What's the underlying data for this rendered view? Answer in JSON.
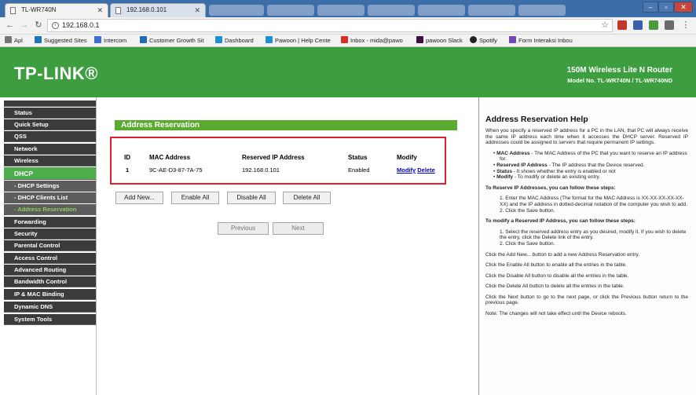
{
  "browser": {
    "tabs": [
      {
        "title": "TL-WR740N"
      },
      {
        "title": "192.168.0.101"
      }
    ],
    "url": "192.168.0.1",
    "bookmarks": [
      {
        "label": "Apl"
      },
      {
        "label": "Suggested Sites"
      },
      {
        "label": "Intercom"
      },
      {
        "label": "Customer Growth Sit"
      },
      {
        "label": "Dashboard"
      },
      {
        "label": "Pawoon | Help Cente"
      },
      {
        "label": "Inbox - mida@pawo"
      },
      {
        "label": "pawoon Slack"
      },
      {
        "label": "Spotify"
      },
      {
        "label": "Form Interaksi Inbou"
      }
    ]
  },
  "header": {
    "logo": "TP-LINK®",
    "product": "150M Wireless Lite N Router",
    "model": "Model No. TL-WR740N / TL-WR740ND"
  },
  "sidebar": {
    "items": [
      {
        "label": "Status"
      },
      {
        "label": "Quick Setup"
      },
      {
        "label": "QSS"
      },
      {
        "label": "Network"
      },
      {
        "label": "Wireless"
      },
      {
        "label": "DHCP"
      },
      {
        "label": "- DHCP Settings"
      },
      {
        "label": "- DHCP Clients List"
      },
      {
        "label": "- Address Reservation"
      },
      {
        "label": "Forwarding"
      },
      {
        "label": "Security"
      },
      {
        "label": "Parental Control"
      },
      {
        "label": "Access Control"
      },
      {
        "label": "Advanced Routing"
      },
      {
        "label": "Bandwidth Control"
      },
      {
        "label": "IP & MAC Binding"
      },
      {
        "label": "Dynamic DNS"
      },
      {
        "label": "System Tools"
      }
    ]
  },
  "main": {
    "section_title": "Address Reservation",
    "table": {
      "headers": [
        "ID",
        "MAC Address",
        "Reserved IP Address",
        "Status",
        "Modify"
      ],
      "rows": [
        {
          "id": "1",
          "mac": "9C-AE-D3-87-7A-75",
          "ip": "192.168.0.101",
          "status": "Enabled",
          "modify": "Modify",
          "delete": "Delete"
        }
      ]
    },
    "buttons": {
      "add_new": "Add New...",
      "enable_all": "Enable All",
      "disable_all": "Disable All",
      "delete_all": "Delete All",
      "previous": "Previous",
      "next": "Next"
    }
  },
  "help": {
    "title": "Address Reservation Help",
    "intro": "When you specify a reserved IP address for a PC in the LAN, that PC will always receive the same IP address each time when it accesses the DHCP server. Reserved IP addresses could be assigned to servers that require permanent IP settings.",
    "bullets": [
      {
        "term": "MAC Address",
        "text": " - The MAC Address of the PC that you want to reserve an IP address for."
      },
      {
        "term": "Reserved IP Address",
        "text": " - The IP address that the Device reserved."
      },
      {
        "term": "Status",
        "text": " - It shows whether the entry is enabled or not"
      },
      {
        "term": "Modify",
        "text": " - To modify or delete an existing entry."
      }
    ],
    "reserve_heading": "To Reserve IP Addresses, you can follow these steps:",
    "reserve_steps": [
      "1. Enter the MAC Address (The format for the MAC Address is XX-XX-XX-XX-XX-XX) and the IP address in dotted-decimal notation of the computer you wish to add.",
      "2. Click the Save button."
    ],
    "modify_heading": "To modify a Reserved IP Address, you can follow these steps:",
    "modify_steps": [
      "1. Select the reserved address entry as you desired, modify it. If you wish to delete the entry, click the Delete link of the entry.",
      "2. Click the Save button."
    ],
    "notes": [
      "Click the Add New... button to add a new Address Reservation entry.",
      "Click the Enable All button to enable all the entries in the table.",
      "Click the Disable All button to disable all the entries in the table.",
      "Click the Delete All button to delete all the entries in the table.",
      "Click the Next button to go to the next page, or click the Previous button return to the previous page.",
      "Note: The changes will not take effect until the Device reboots."
    ]
  },
  "colors": {
    "brand_green": "#3c9e3e",
    "section_green": "#5aaa2e",
    "sidebar_dark": "#3b3b3b",
    "highlight_red": "#e0202a"
  }
}
